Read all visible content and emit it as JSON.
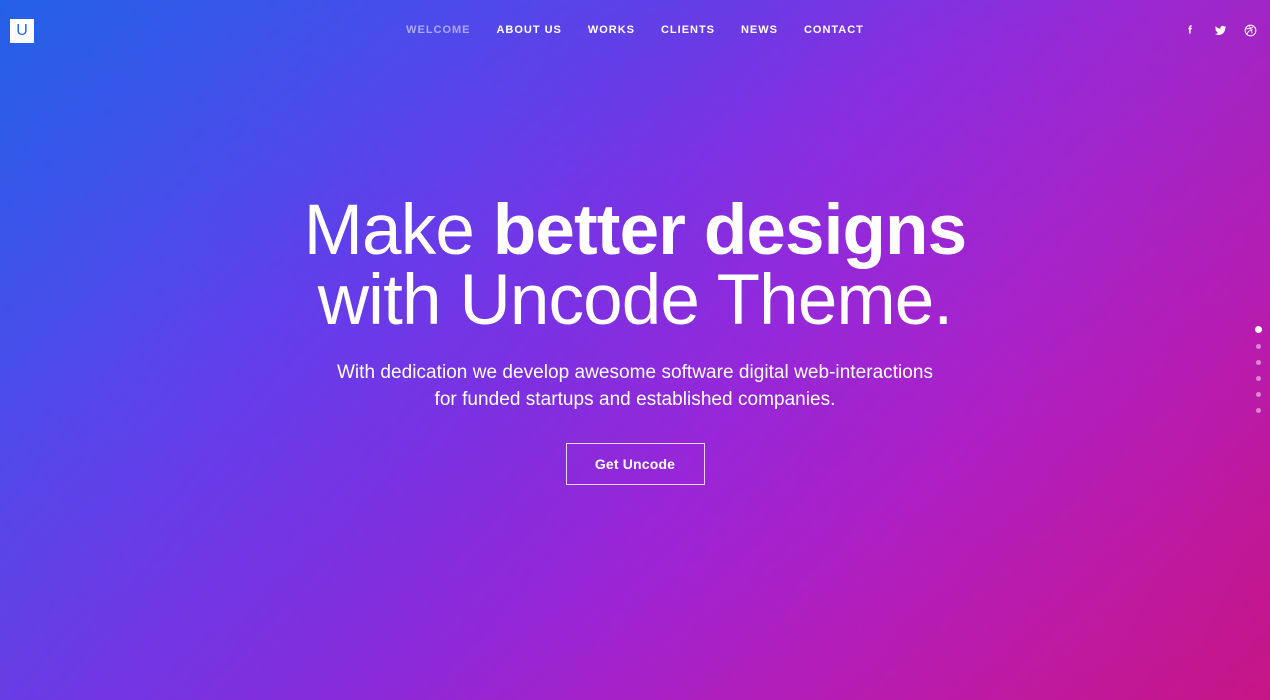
{
  "header": {
    "logo": {
      "letter": "U",
      "icon": "uncode-logo-icon"
    },
    "nav": [
      {
        "label": "WELCOME",
        "active": true
      },
      {
        "label": "ABOUT US",
        "active": false
      },
      {
        "label": "WORKS",
        "active": false
      },
      {
        "label": "CLIENTS",
        "active": false
      },
      {
        "label": "NEWS",
        "active": false
      },
      {
        "label": "CONTACT",
        "active": false
      }
    ],
    "social": [
      {
        "name": "facebook-icon",
        "label": "Facebook"
      },
      {
        "name": "twitter-icon",
        "label": "Twitter"
      },
      {
        "name": "dribbble-icon",
        "label": "Dribbble"
      }
    ]
  },
  "hero": {
    "title_line1_light": "Make ",
    "title_line1_bold": "better designs",
    "title_line2": "with Uncode Theme.",
    "subtitle_line1": "With dedication we develop awesome software digital web-interactions",
    "subtitle_line2": "for funded startups and established companies.",
    "cta_label": "Get Uncode"
  },
  "dot_nav": {
    "count": 6,
    "active_index": 0,
    "slides": [
      "1",
      "2",
      "3",
      "4",
      "5",
      "6"
    ]
  },
  "colors": {
    "gradient_start": "#1f63e8",
    "gradient_mid": "#7b2fd4",
    "gradient_end": "#cc1178",
    "logo_bg": "#ffffff",
    "logo_letter": "#2a63e4",
    "text": "#ffffff"
  }
}
